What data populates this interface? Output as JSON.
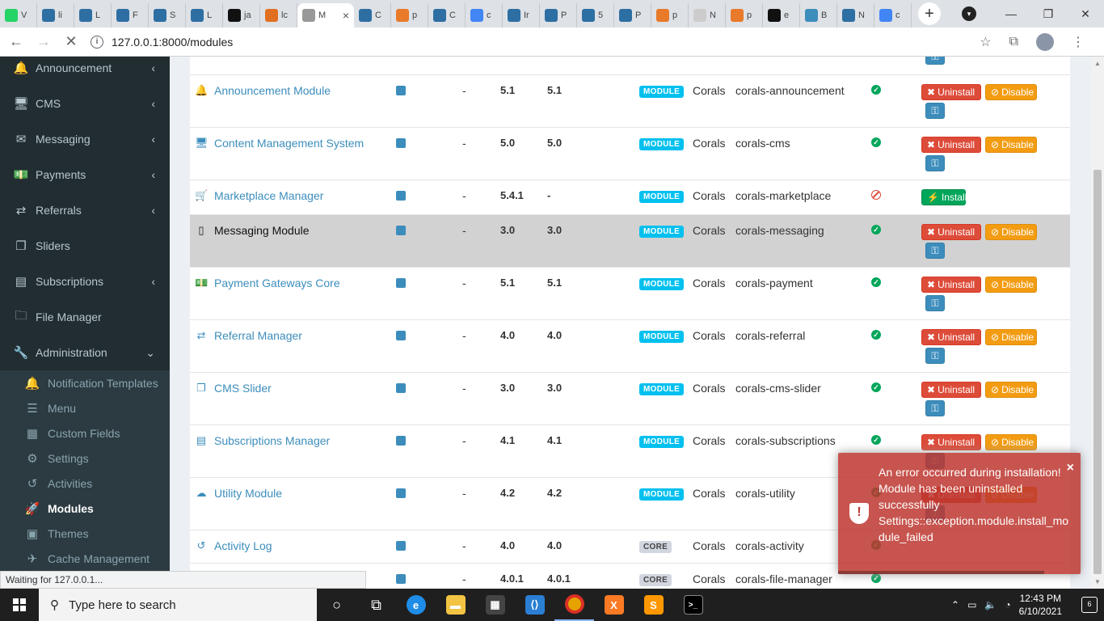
{
  "browser": {
    "tabs": [
      {
        "label": "V",
        "favicon": "whatsapp-icon",
        "color": "#25d366"
      },
      {
        "label": "li",
        "favicon": "laravel-icon",
        "color": "#2d6fa3"
      },
      {
        "label": "L",
        "favicon": "laravel-icon",
        "color": "#2d6fa3"
      },
      {
        "label": "F",
        "favicon": "laravel-icon",
        "color": "#2d6fa3"
      },
      {
        "label": "S",
        "favicon": "laravel-icon",
        "color": "#2d6fa3"
      },
      {
        "label": "L",
        "favicon": "laravel-icon",
        "color": "#2d6fa3"
      },
      {
        "label": "ja",
        "favicon": "github-icon",
        "color": "#111"
      },
      {
        "label": "lc",
        "favicon": "xampp-icon",
        "color": "#e07020"
      },
      {
        "label": "M",
        "favicon": "corals-icon",
        "color": "#999",
        "active": true
      },
      {
        "label": "C",
        "favicon": "laravel-icon",
        "color": "#2d6fa3"
      },
      {
        "label": "p",
        "favicon": "stack-icon",
        "color": "#e87a2a"
      },
      {
        "label": "C",
        "favicon": "laravel-icon",
        "color": "#2d6fa3"
      },
      {
        "label": "c",
        "favicon": "google-icon",
        "color": "#4285f4"
      },
      {
        "label": "Ir",
        "favicon": "laravel-icon",
        "color": "#2d6fa3"
      },
      {
        "label": "P",
        "favicon": "laravel-icon",
        "color": "#2d6fa3"
      },
      {
        "label": "5",
        "favicon": "laravel-icon",
        "color": "#2d6fa3"
      },
      {
        "label": "P",
        "favicon": "laravel-icon",
        "color": "#2d6fa3"
      },
      {
        "label": "p",
        "favicon": "stack-icon",
        "color": "#e87a2a"
      },
      {
        "label": "N",
        "favicon": "blank-icon",
        "color": "#ccc"
      },
      {
        "label": "p",
        "favicon": "stack-icon",
        "color": "#e87a2a"
      },
      {
        "label": "e",
        "favicon": "info-icon",
        "color": "#111"
      },
      {
        "label": "B",
        "favicon": "bootstrap-icon",
        "color": "#3c8dbc"
      },
      {
        "label": "N",
        "favicon": "laravel-icon",
        "color": "#2d6fa3"
      },
      {
        "label": "c",
        "favicon": "google-icon",
        "color": "#4285f4"
      }
    ],
    "url": "127.0.0.1:8000/modules",
    "status_text": "Waiting for 127.0.0.1..."
  },
  "sidebar": {
    "items": [
      {
        "label": "Announcement",
        "icon": "bell-icon",
        "glyph": "🔔",
        "chevron": "‹"
      },
      {
        "label": "CMS",
        "icon": "desktop-icon",
        "glyph": "🖥",
        "chevron": "‹"
      },
      {
        "label": "Messaging",
        "icon": "envelope-icon",
        "glyph": "✉",
        "chevron": "‹"
      },
      {
        "label": "Payments",
        "icon": "money-icon",
        "glyph": "💵",
        "chevron": "‹"
      },
      {
        "label": "Referrals",
        "icon": "retweet-icon",
        "glyph": "⇄",
        "chevron": "‹"
      },
      {
        "label": "Sliders",
        "icon": "clone-icon",
        "glyph": "❐",
        "chevron": ""
      },
      {
        "label": "Subscriptions",
        "icon": "id-card-icon",
        "glyph": "▤",
        "chevron": "‹"
      },
      {
        "label": "File Manager",
        "icon": "folder-icon",
        "glyph": "🗀",
        "chevron": ""
      },
      {
        "label": "Administration",
        "icon": "wrench-icon",
        "glyph": "🔧",
        "chevron": "⌄"
      }
    ],
    "sub_items": [
      {
        "label": "Notification Templates",
        "icon": "bell-icon",
        "glyph": "🔔"
      },
      {
        "label": "Menu",
        "icon": "bars-icon",
        "glyph": "☰"
      },
      {
        "label": "Custom Fields",
        "icon": "database-icon",
        "glyph": "▦"
      },
      {
        "label": "Settings",
        "icon": "cogs-icon",
        "glyph": "⚙"
      },
      {
        "label": "Activities",
        "icon": "history-icon",
        "glyph": "↺"
      },
      {
        "label": "Modules",
        "icon": "rocket-icon",
        "glyph": "🚀",
        "active": true
      },
      {
        "label": "Themes",
        "icon": "image-icon",
        "glyph": "▣"
      },
      {
        "label": "Cache Management",
        "icon": "plane-icon",
        "glyph": "✈"
      }
    ]
  },
  "modules": {
    "rows": [
      {
        "name": "Announcement Module",
        "icon": "bell-icon",
        "glyph": "🔔",
        "note": "-",
        "v1": "5.1",
        "v2": "5.1",
        "type": "MODULE",
        "author": "Corals",
        "package": "corals-announcement",
        "status": "enabled",
        "installed": true
      },
      {
        "name": "Content Management System",
        "icon": "desktop-icon",
        "glyph": "🖥",
        "note": "-",
        "v1": "5.0",
        "v2": "5.0",
        "type": "MODULE",
        "author": "Corals",
        "package": "corals-cms",
        "status": "enabled",
        "installed": true
      },
      {
        "name": "Marketplace Manager",
        "icon": "cart-icon",
        "glyph": "🛒",
        "note": "-",
        "v1": "5.4.1",
        "v2": "-",
        "type": "MODULE",
        "author": "Corals",
        "package": "corals-marketplace",
        "status": "disabled",
        "installed": false
      },
      {
        "name": "Messaging Module",
        "icon": "mobile-icon",
        "glyph": "▯",
        "note": "-",
        "v1": "3.0",
        "v2": "3.0",
        "type": "MODULE",
        "author": "Corals",
        "package": "corals-messaging",
        "status": "enabled",
        "installed": true,
        "highlight": true
      },
      {
        "name": "Payment Gateways Core",
        "icon": "money-icon",
        "glyph": "💵",
        "note": "-",
        "v1": "5.1",
        "v2": "5.1",
        "type": "MODULE",
        "author": "Corals",
        "package": "corals-payment",
        "status": "enabled",
        "installed": true
      },
      {
        "name": "Referral Manager",
        "icon": "retweet-icon",
        "glyph": "⇄",
        "note": "-",
        "v1": "4.0",
        "v2": "4.0",
        "type": "MODULE",
        "author": "Corals",
        "package": "corals-referral",
        "status": "enabled",
        "installed": true
      },
      {
        "name": "CMS Slider",
        "icon": "clone-icon",
        "glyph": "❐",
        "note": "-",
        "v1": "3.0",
        "v2": "3.0",
        "type": "MODULE",
        "author": "Corals",
        "package": "corals-cms-slider",
        "status": "enabled",
        "installed": true
      },
      {
        "name": "Subscriptions Manager",
        "icon": "id-card-icon",
        "glyph": "▤",
        "note": "-",
        "v1": "4.1",
        "v2": "4.1",
        "type": "MODULE",
        "author": "Corals",
        "package": "corals-subscriptions",
        "status": "enabled",
        "installed": true
      },
      {
        "name": "Utility Module",
        "icon": "cloud-icon",
        "glyph": "☁",
        "note": "-",
        "v1": "4.2",
        "v2": "4.2",
        "type": "MODULE",
        "author": "Corals",
        "package": "corals-utility",
        "status": "enabled",
        "installed": true
      },
      {
        "name": "Activity Log",
        "icon": "history-icon",
        "glyph": "↺",
        "note": "-",
        "v1": "4.0",
        "v2": "4.0",
        "type": "CORE",
        "author": "Corals",
        "package": "corals-activity",
        "status": "enabled",
        "installed": false
      },
      {
        "name": "",
        "icon": "",
        "glyph": "",
        "note": "-",
        "v1": "4.0.1",
        "v2": "4.0.1",
        "type": "CORE",
        "author": "Corals",
        "package": "corals-file-manager",
        "status": "enabled",
        "installed": false
      }
    ],
    "labels": {
      "uninstall": "Uninstall",
      "disable": "Disable",
      "install": "Install"
    }
  },
  "toast": {
    "lines": [
      "An error occurred during installation!",
      "Module has been uninstalled successfully",
      "Settings::exception.module.install_module_failed"
    ],
    "close": "×"
  },
  "taskbar": {
    "search_placeholder": "Type here to search",
    "time": "12:43 PM",
    "date": "6/10/2021",
    "notification_count": "6"
  }
}
